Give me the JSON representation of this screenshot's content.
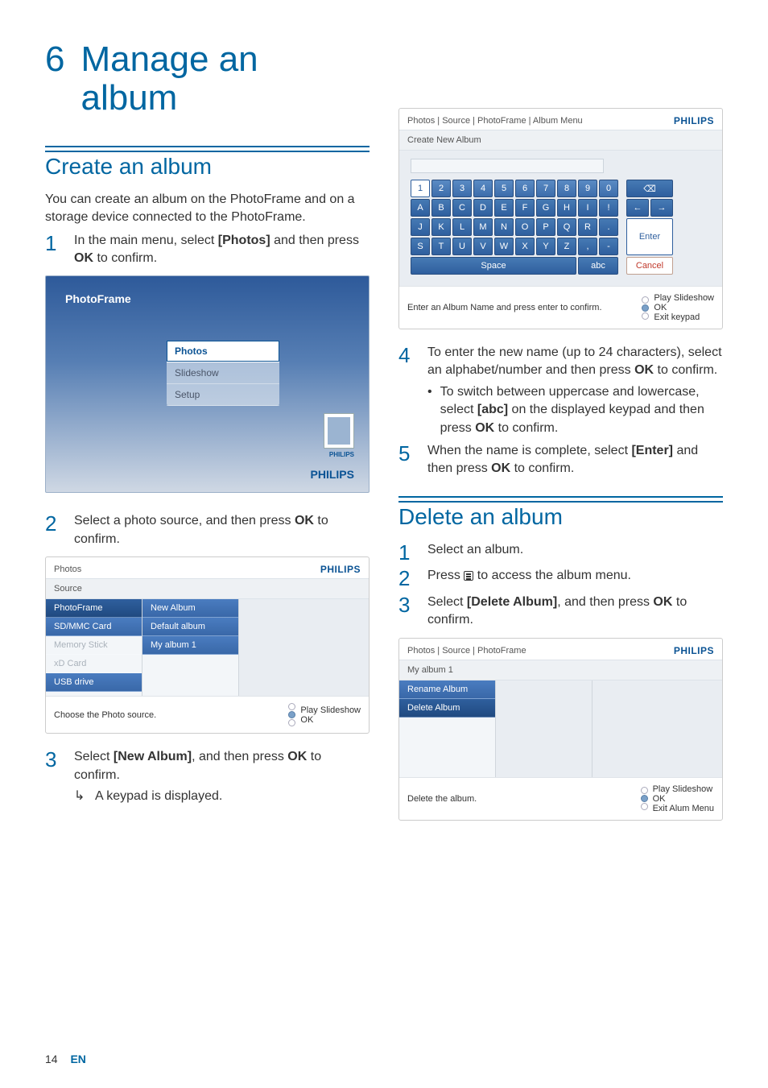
{
  "chapter": {
    "number": "6",
    "title_line1": "Manage an",
    "title_line2": "album"
  },
  "section_create": "Create an album",
  "intro": "You can create an album on the PhotoFrame and on a storage device connected to the PhotoFrame.",
  "steps_create": {
    "s1_a": "In the main menu, select ",
    "s1_b": "[Photos]",
    "s1_c": " and then press ",
    "s1_d": "OK",
    "s1_e": " to confirm.",
    "s2_a": "Select a photo source, and then press ",
    "s2_b": "OK",
    "s2_c": " to confirm.",
    "s3_a": "Select ",
    "s3_b": "[New Album]",
    "s3_c": ", and then press ",
    "s3_d": "OK",
    "s3_e": " to confirm.",
    "s3_arrow": "A keypad is displayed.",
    "s4_a": "To enter the new name (up to 24 characters), select an alphabet/number and then press ",
    "s4_b": "OK",
    "s4_c": " to confirm.",
    "s4_sub_a": "To switch between uppercase and lowercase, select ",
    "s4_sub_b": "[abc]",
    "s4_sub_c": " on the displayed keypad and then press ",
    "s4_sub_d": "OK",
    "s4_sub_e": " to confirm.",
    "s5_a": "When the name is complete, select ",
    "s5_b": "[Enter]",
    "s5_c": " and then press ",
    "s5_d": "OK",
    "s5_e": " to confirm."
  },
  "section_delete": "Delete an album",
  "steps_delete": {
    "s1": "Select an album.",
    "s2_a": "Press ",
    "s2_b": " to access the album menu.",
    "s3_a": "Select ",
    "s3_b": "[Delete Album]",
    "s3_c": ", and then press ",
    "s3_d": "OK",
    "s3_e": " to confirm."
  },
  "shot_hero": {
    "title": "PhotoFrame",
    "items": [
      "Photos",
      "Slideshow",
      "Setup"
    ],
    "brand": "PHILIPS",
    "thumb_brand": "PHILIPS"
  },
  "shot_source": {
    "breadcrumb": "Photos",
    "brand": "PHILIPS",
    "subbar": "Source",
    "col1": [
      "PhotoFrame",
      "SD/MMC Card",
      "Memory Stick",
      "xD Card",
      "USB drive"
    ],
    "col2": [
      "New Album",
      "Default album",
      "My album 1"
    ],
    "footer_left": "Choose the Photo source.",
    "footer_right": [
      "Play Slideshow",
      "OK"
    ]
  },
  "shot_keypad": {
    "breadcrumb": "Photos | Source | PhotoFrame | Album Menu",
    "brand": "PHILIPS",
    "subbar": "Create New Album",
    "row1": [
      "1",
      "2",
      "3",
      "4",
      "5",
      "6",
      "7",
      "8",
      "9",
      "0"
    ],
    "row2": [
      "A",
      "B",
      "C",
      "D",
      "E",
      "F",
      "G",
      "H",
      "I",
      "!"
    ],
    "row3": [
      "J",
      "K",
      "L",
      "M",
      "N",
      "O",
      "P",
      "Q",
      "R",
      "."
    ],
    "row4": [
      "S",
      "T",
      "U",
      "V",
      "W",
      "X",
      "Y",
      "Z",
      ",",
      "-"
    ],
    "space": "Space",
    "abc": "abc",
    "backspace": "⌫",
    "left": "←",
    "right": "→",
    "enter": "Enter",
    "cancel": "Cancel",
    "footer_left": "Enter an Album Name and press enter to confirm.",
    "footer_right": [
      "Play Slideshow",
      "OK",
      "Exit keypad"
    ]
  },
  "shot_delete": {
    "breadcrumb": "Photos | Source | PhotoFrame",
    "brand": "PHILIPS",
    "subbar": "My album 1",
    "items": [
      "Rename Album",
      "Delete Album"
    ],
    "footer_left": "Delete the album.",
    "footer_right": [
      "Play Slideshow",
      "OK",
      "Exit Alum Menu"
    ]
  },
  "footer": {
    "page": "14",
    "lang": "EN"
  }
}
